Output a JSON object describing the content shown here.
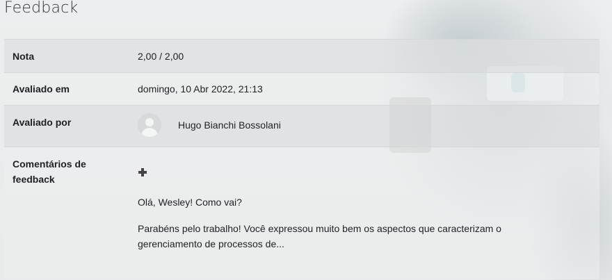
{
  "page": {
    "title": "Feedback"
  },
  "feedback": {
    "grade": {
      "label": "Nota",
      "value": "2,00 / 2,00"
    },
    "graded_on": {
      "label": "Avaliado em",
      "value": "domingo, 10 Abr 2022, 21:13"
    },
    "graded_by": {
      "label": "Avaliado por",
      "avatar_icon": "user-avatar-icon",
      "name": "Hugo Bianchi Bossolani"
    },
    "comments": {
      "label": "Comentários de feedback",
      "expand_icon": "plus-icon",
      "greeting": "Olá, Wesley! Como vai?",
      "body": "Parabéns pelo trabalho! Você expressou muito bem os aspectos que caracterizam o gerenciamento de processos de..."
    }
  },
  "colors": {
    "text": "#1d2125",
    "row_shaded": "#dcdfe1",
    "border": "#d4d6d8",
    "background": "#e9ebec"
  }
}
